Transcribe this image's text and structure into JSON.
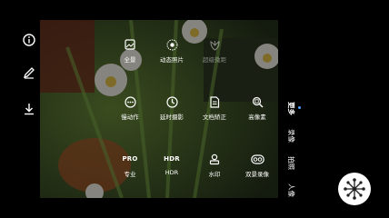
{
  "left_toolbar": {
    "icons": [
      "info-icon",
      "edit-icon",
      "download-icon"
    ]
  },
  "modes_row1": [
    {
      "label": "全景",
      "icon": "panorama-icon"
    },
    {
      "label": "动态照片",
      "icon": "motion-photo-icon"
    },
    {
      "label": "超级微距",
      "icon": "super-macro-icon",
      "dimmed": true
    }
  ],
  "modes_row2": [
    {
      "label": "慢动作",
      "icon": "slow-motion-icon"
    },
    {
      "label": "延时摄影",
      "icon": "timelapse-icon"
    },
    {
      "label": "文档矫正",
      "icon": "document-correction-icon"
    },
    {
      "label": "高像素",
      "icon": "high-pixel-icon"
    }
  ],
  "modes_row3": [
    {
      "label": "专业",
      "icon_text": "PRO"
    },
    {
      "label": "HDR",
      "icon_text": "HDR"
    },
    {
      "label": "水印",
      "icon": "watermark-icon"
    },
    {
      "label": "双景录像",
      "icon": "dual-view-icon"
    }
  ],
  "right_tabs": [
    {
      "label": "更多",
      "active": true
    },
    {
      "label": "录像"
    },
    {
      "label": "拍照"
    },
    {
      "label": "人像"
    }
  ],
  "colors": {
    "accent": "#4da3ff"
  }
}
